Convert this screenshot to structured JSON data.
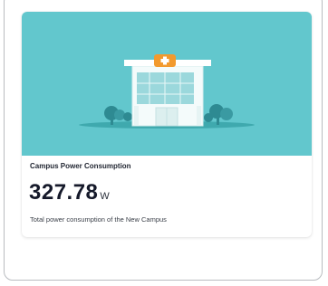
{
  "card": {
    "title": "Campus Power Consumption",
    "value": "327.78",
    "unit": "W",
    "description": "Total power consumption of the New Campus"
  },
  "illustration": {
    "icon": "hospital-building-icon",
    "background_color": "#62c7cd",
    "accent_color": "#f29a2e"
  }
}
